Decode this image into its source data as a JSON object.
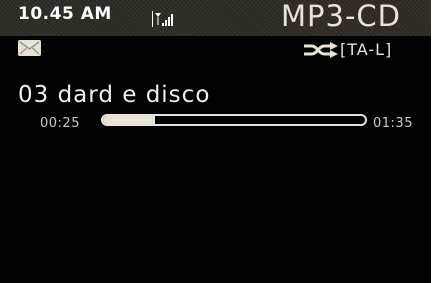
{
  "status": {
    "time": "10.45 AM",
    "signal_icon": "signal-icon"
  },
  "app": {
    "title": "MP3-CD"
  },
  "notifications": {
    "mail_icon": "mail-icon"
  },
  "playback": {
    "shuffle_icon": "shuffle-icon",
    "mode": "[TA-L]",
    "track_title": "03 dard e disco",
    "elapsed": "00:25",
    "total": "01:35",
    "progress_fraction": 0.2
  },
  "colors": {
    "background": "#000000",
    "topbar": "#2f2a24",
    "text": "#e8e3d6"
  }
}
